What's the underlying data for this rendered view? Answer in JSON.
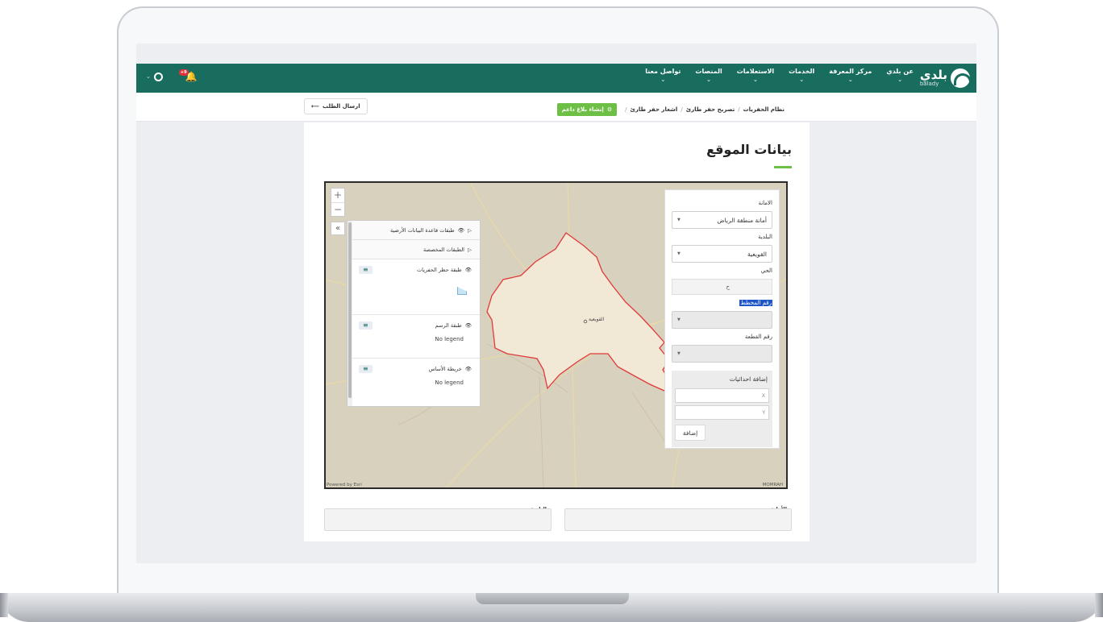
{
  "nav": {
    "logo_ar": "بلدي",
    "logo_en": "balady",
    "menu": [
      {
        "label": "عن بلدي"
      },
      {
        "label": "مركز المعرفة"
      },
      {
        "label": "الخدمات"
      },
      {
        "label": "الاستعلامات"
      },
      {
        "label": "المنصات"
      },
      {
        "label": "تواصل معنا"
      }
    ],
    "notification_badge": "+9"
  },
  "breadcrumb": {
    "items": [
      "نظام الحفريات",
      "تصريح حفر طارئ",
      "اشعار حفر طارئ"
    ],
    "report_button": "إنشاء بلاغ داعم",
    "send_button": "ارسال الطلب"
  },
  "page": {
    "title": "بيانات الموقع"
  },
  "map": {
    "zoom_in": "+",
    "zoom_out": "−",
    "collapse": "«",
    "place_label": "القويعية",
    "attribution_left": "Powered by Esri",
    "attribution_right": "MOMRAH",
    "layers": {
      "rows": [
        {
          "label": "طبقات قاعدة البيانات الأرضية"
        },
        {
          "label": "الطبقات المخصصة"
        }
      ],
      "blocks": [
        {
          "label": "طبقة حظر الحفريات",
          "legend": ""
        },
        {
          "label": "طبقة الرسم",
          "legend": "No legend"
        },
        {
          "label": "خريطة الأساس",
          "legend": "No legend"
        }
      ]
    },
    "filter": {
      "amanah_label": "الامانة",
      "amanah_value": "أمانة منطقة الرياض",
      "baladiya_label": "البلدية",
      "baladiya_value": "القويعية",
      "district_label": "الحي",
      "district_value": "ح",
      "plan_label": "رقم المخطط",
      "plot_label": "رقم القطعة",
      "coords_title": "إضافة احداثيات",
      "x_placeholder": "X",
      "y_placeholder": "Y",
      "add_button": "إضافة"
    }
  },
  "bottom_fields": {
    "amanah_label": "الأمانة",
    "baladiya_label": "البلدية"
  },
  "colors": {
    "brand_green": "#196d5f",
    "accent_green": "#6dbf45",
    "boundary_red": "#e03a3a"
  }
}
